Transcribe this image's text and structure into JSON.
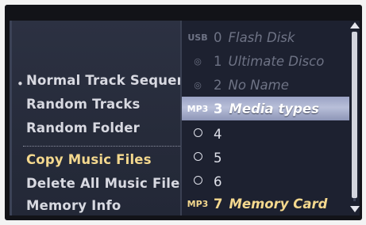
{
  "left_menu": {
    "items": [
      {
        "label": "Normal Track Sequence",
        "bullet": "•"
      },
      {
        "label": "Random Tracks"
      },
      {
        "label": "Random Folder"
      },
      {
        "label": "Copy Music Files"
      },
      {
        "label": "Delete All Music Files"
      },
      {
        "label": "Memory Info"
      }
    ]
  },
  "media_list": {
    "items": [
      {
        "icon": "usb-icon",
        "icon_text": "USB",
        "number": "0",
        "name": "Flash Disk"
      },
      {
        "icon": "disc-icon",
        "icon_text": "◎",
        "number": "1",
        "name": "Ultimate Disco"
      },
      {
        "icon": "disc-icon",
        "icon_text": "◎",
        "number": "2",
        "name": "No Name"
      },
      {
        "icon": "mp3-icon",
        "icon_text": "MP3",
        "number": "3",
        "name": "Media types"
      },
      {
        "icon": "empty-slot-icon",
        "number": "4",
        "name": ""
      },
      {
        "icon": "empty-slot-icon",
        "number": "5",
        "name": ""
      },
      {
        "icon": "empty-slot-icon",
        "number": "6",
        "name": ""
      },
      {
        "icon": "mp3-memory-icon",
        "icon_text": "MP3",
        "number": "7",
        "name": "Memory Card"
      }
    ],
    "selected_index": 3
  },
  "colors": {
    "accent_gold": "#f4d88e",
    "selection": "#b8bfd9",
    "highlight_line": "#ff6a1a"
  }
}
